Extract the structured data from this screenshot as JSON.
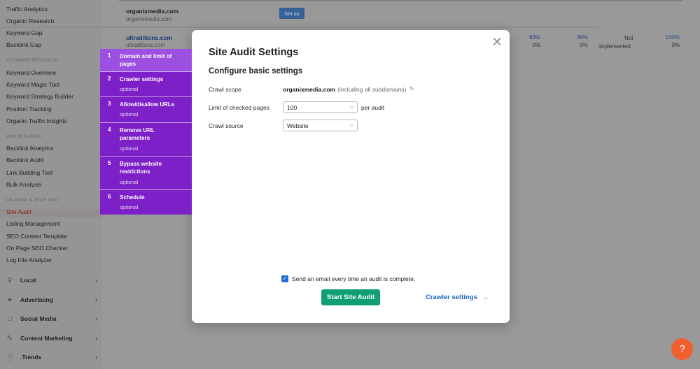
{
  "sidebar": {
    "top_items": [
      "Traffic Analytics",
      "Organic Research",
      "Keyword Gap",
      "Backlink Gap"
    ],
    "keyword_research_label": "KEYWORD RESEARCH",
    "keyword_research_items": [
      "Keyword Overview",
      "Keyword Magic Tool",
      "Keyword Strategy Builder",
      "Position Tracking",
      "Organic Traffic Insights"
    ],
    "link_building_label": "LINK BUILDING",
    "link_building_items": [
      "Backlink Analytics",
      "Backlink Audit",
      "Link Building Tool",
      "Bulk Analysis"
    ],
    "onpage_label": "ON PAGE & TECH SEO",
    "onpage_items": [
      "Site Audit",
      "Listing Management",
      "SEO Content Template",
      "On Page SEO Checker",
      "Log File Analyzer"
    ],
    "groups": [
      {
        "label": "Local",
        "icon": "location-pin-icon"
      },
      {
        "label": "Advertising",
        "icon": "crosshair-icon"
      },
      {
        "label": "Social Media",
        "icon": "chat-bubble-icon"
      },
      {
        "label": "Content Marketing",
        "icon": "pencil-icon"
      },
      {
        "label": ".Trends",
        "icon": "bar-chart-icon"
      }
    ]
  },
  "background": {
    "row1": {
      "domain": "organixmedia.com",
      "sub": "organixmedia.com",
      "button": "Set up"
    },
    "row2": {
      "domain": "ultraditions.com",
      "sub": "ultraditions.com",
      "col1": "93%",
      "col1b": "0%",
      "col2": "99%",
      "col2b": "0%",
      "col3a": "Not",
      "col3b": "implemented",
      "col4": "100%",
      "col4b": "0%"
    }
  },
  "modal": {
    "title": "Site Audit Settings",
    "subtitle": "Configure basic settings",
    "crawl_scope_label": "Crawl scope",
    "crawl_scope_domain": "organixmedia.com",
    "crawl_scope_note": "(including all subdomains)",
    "limit_label": "Limit of checked pages",
    "limit_value": "100",
    "per_audit": "per audit",
    "source_label": "Crawl source",
    "source_value": "Website",
    "email_label": "Send an email every time an audit is complete.",
    "start_button": "Start Site Audit",
    "next_link": "Crawler settings"
  },
  "steps": [
    {
      "num": "1",
      "title": "Domain and limit of pages",
      "optional": ""
    },
    {
      "num": "2",
      "title": "Crawler settings",
      "optional": "optional"
    },
    {
      "num": "3",
      "title": "Allow/disallow URLs",
      "optional": "optional"
    },
    {
      "num": "4",
      "title": "Remove URL parameters",
      "optional": "optional"
    },
    {
      "num": "5",
      "title": "Bypass website restrictions",
      "optional": "optional"
    },
    {
      "num": "6",
      "title": "Schedule",
      "optional": "optional"
    }
  ],
  "help": {
    "label": "?"
  },
  "colors": {
    "accent_purple": "#7e20c8",
    "active_step": "#9c4fe0",
    "start_button": "#0f9e76",
    "link_blue": "#1a65c8",
    "help_orange": "#f15f2c"
  }
}
